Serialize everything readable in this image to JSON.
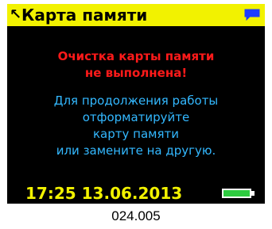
{
  "header": {
    "back_glyph": "↖",
    "title": "Карта памяти",
    "icon": "message-icon"
  },
  "message": {
    "error_lines": [
      "Очистка карты памяти",
      "не выполнена!"
    ],
    "info_lines": [
      "Для продолжения работы",
      "отформатируйте",
      "карту памяти",
      "или замените на другую."
    ]
  },
  "status": {
    "time": "17:25",
    "date": "13.06.2013",
    "battery_icon": "battery-full-icon",
    "battery_level": 1.0
  },
  "caption": "024.005",
  "colors": {
    "screen_background": "#000000",
    "title_bar": "#f2f200",
    "error_text": "#ff1a1a",
    "info_text": "#33b8ff",
    "status_text": "#f2f200",
    "battery": "#2ecc40"
  }
}
